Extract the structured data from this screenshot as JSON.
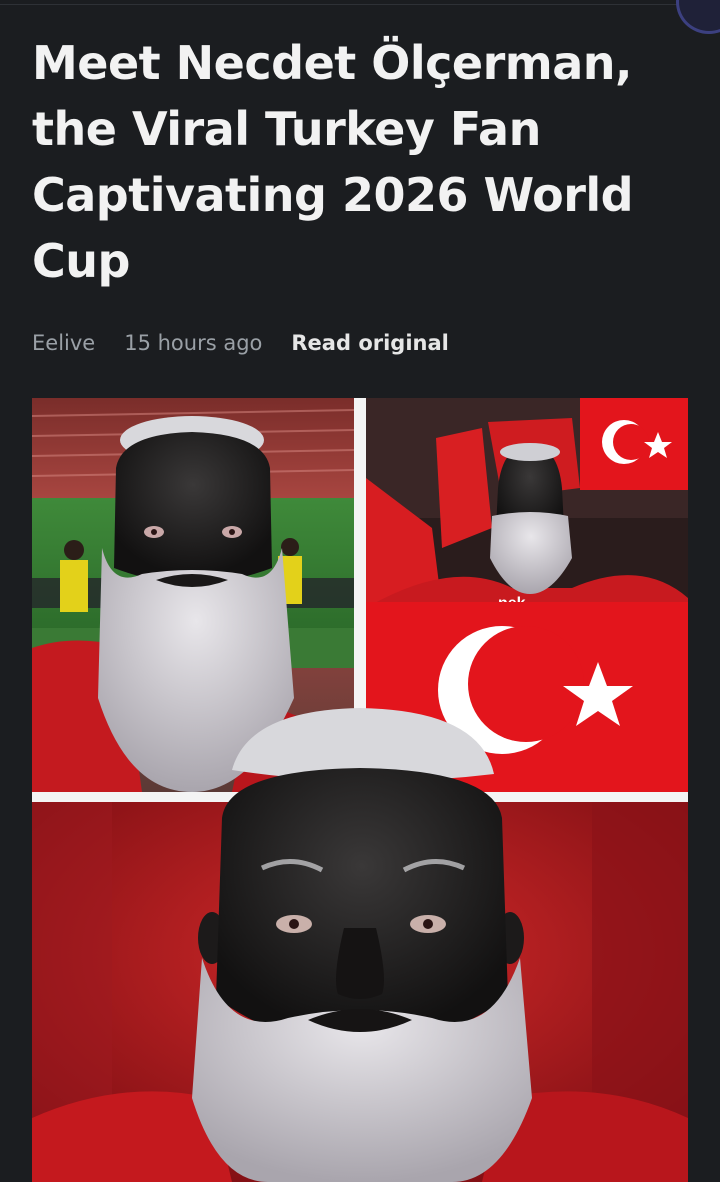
{
  "article": {
    "title": "Meet Necdet Ölçerman, the Viral Turkey Fan Captivating 2026 World Cup",
    "source": "Eelive",
    "time_ago": "15 hours ago",
    "read_original_label": "Read original"
  },
  "image": {
    "jacket_text": "nek"
  },
  "colors": {
    "background": "#1b1d20",
    "title": "#f2f2f2",
    "meta": "#9aa0a6",
    "flag_red": "#e3151c"
  }
}
